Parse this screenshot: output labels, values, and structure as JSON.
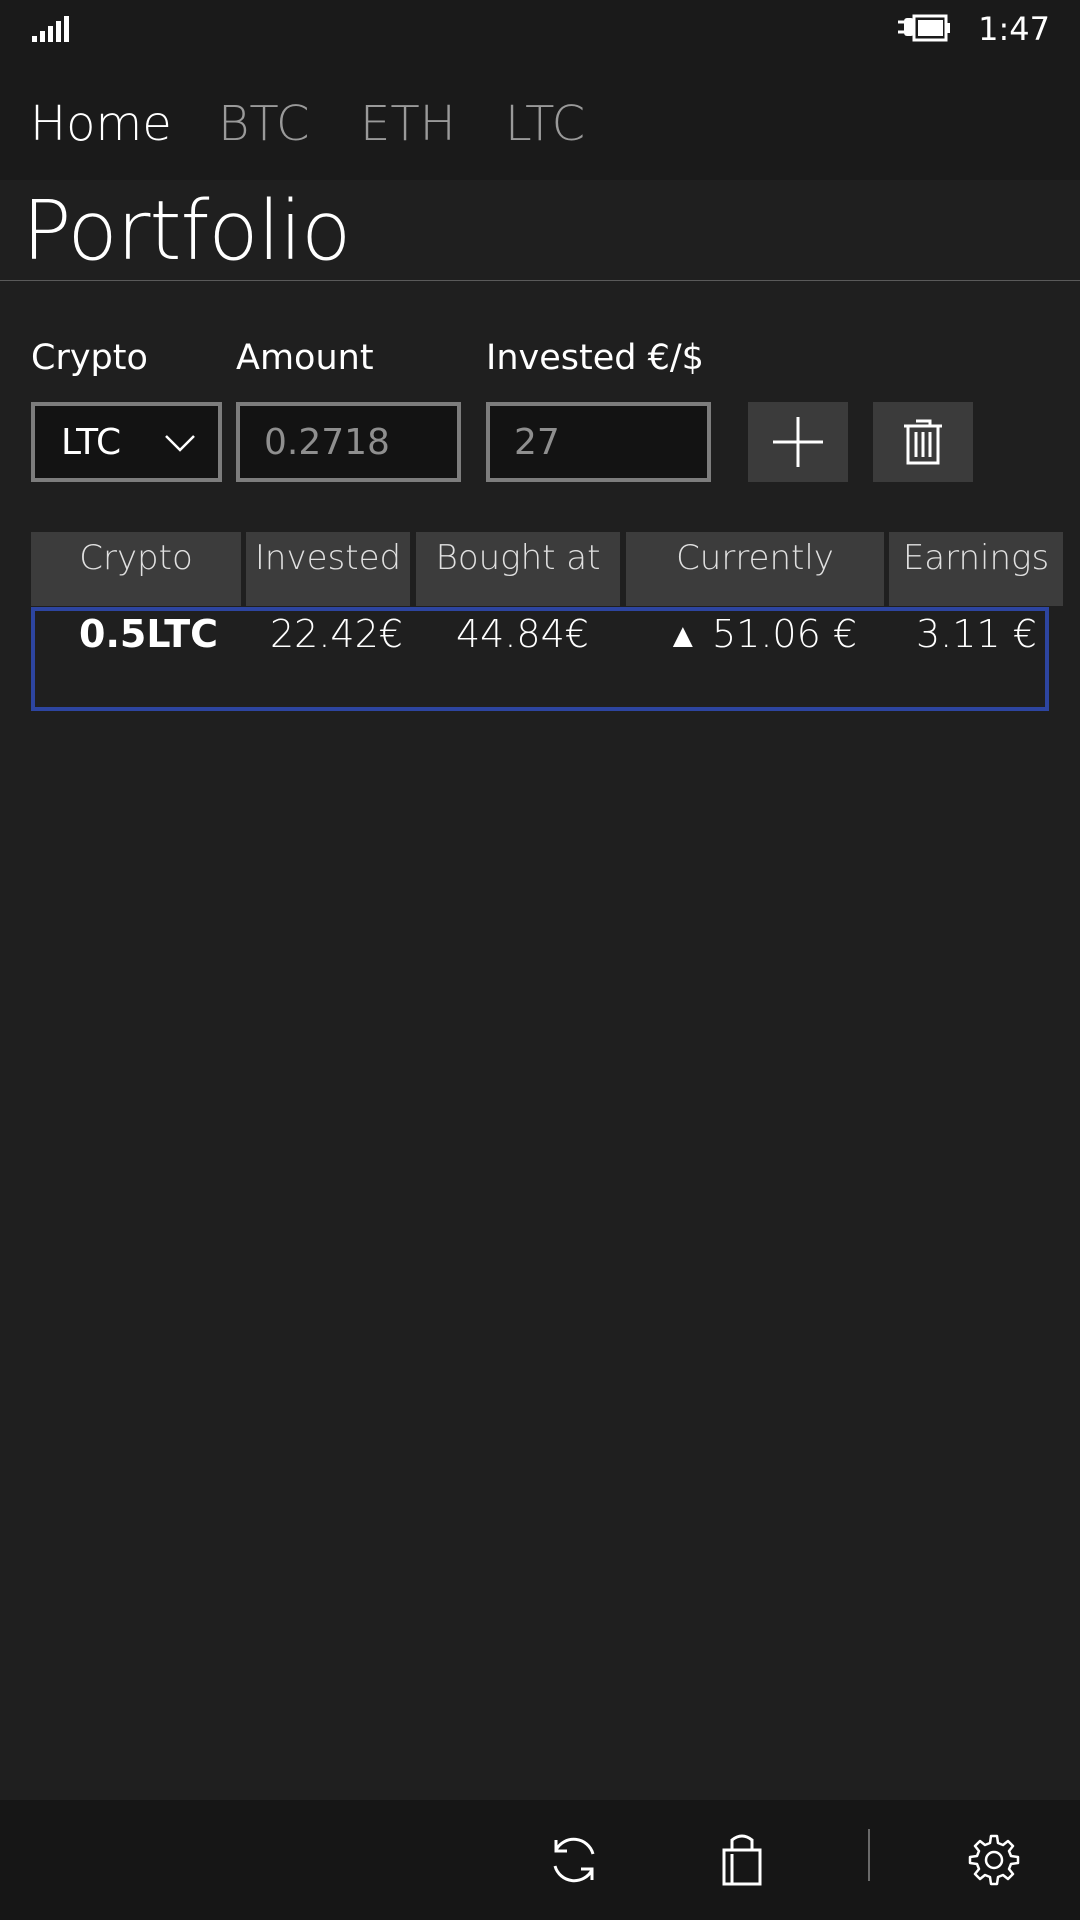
{
  "status": {
    "time": "1:47"
  },
  "nav": {
    "tabs": [
      {
        "label": "Home",
        "active": true
      },
      {
        "label": "BTC",
        "active": false
      },
      {
        "label": "ETH",
        "active": false
      },
      {
        "label": "LTC",
        "active": false
      }
    ]
  },
  "page": {
    "title": "Portfolio"
  },
  "form": {
    "crypto_label": "Crypto",
    "amount_label": "Amount",
    "invested_label": "Invested €/$",
    "crypto_value": "LTC",
    "amount_value": "0.2718",
    "invested_value": "27"
  },
  "table": {
    "headers": [
      "Crypto",
      "Invested",
      "Bought at",
      "Currently",
      "Earnings"
    ],
    "rows": [
      {
        "crypto": "0.5LTC",
        "invested": "22.42€",
        "bought_at": "44.84€",
        "trend": "▲",
        "currently": "51.06 €",
        "earnings": "3.11 €"
      }
    ]
  },
  "icons": {
    "add": "plus-icon",
    "delete": "trash-icon",
    "refresh": "refresh-icon",
    "store": "shopping-bag-icon",
    "settings": "gear-icon"
  },
  "colors": {
    "background": "#1f1f1f",
    "selection": "#2d45a0"
  }
}
